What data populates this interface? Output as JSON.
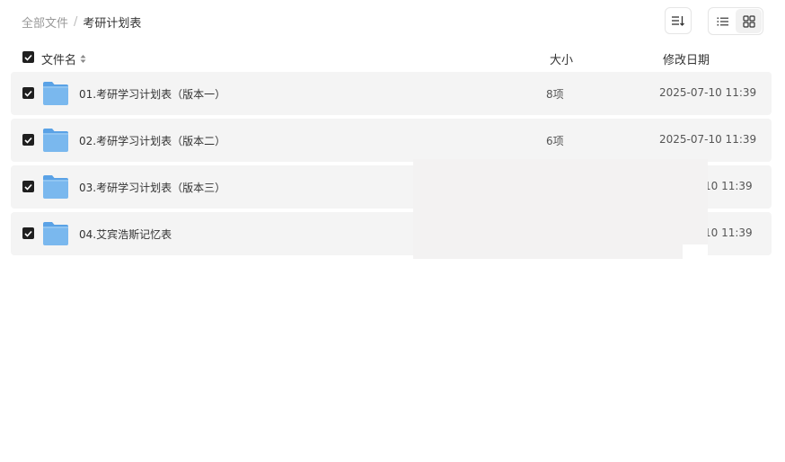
{
  "breadcrumb": {
    "root": "全部文件",
    "separator": "/",
    "current": "考研计划表"
  },
  "toolbar": {
    "sort_icon": "sort-icon",
    "list_view_icon": "list-view-icon",
    "grid_view_icon": "grid-view-icon"
  },
  "header": {
    "name": "文件名",
    "size": "大小",
    "date": "修改日期"
  },
  "rows": [
    {
      "name": "01.考研学习计划表（版本一）",
      "size": "8项",
      "date": "2025-07-10 11:39"
    },
    {
      "name": "02.考研学习计划表（版本二）",
      "size": "6项",
      "date": "2025-07-10 11:39"
    },
    {
      "name": "03.考研学习计划表（版本三）",
      "size": "",
      "date": "10 11:39"
    },
    {
      "name": "04.艾宾浩斯记忆表",
      "size": "",
      "date": "10 11:39"
    }
  ],
  "colors": {
    "row_background": "#f4f4f4",
    "checkbox": "#1f1f1f",
    "folder": "#7ab8ee"
  }
}
